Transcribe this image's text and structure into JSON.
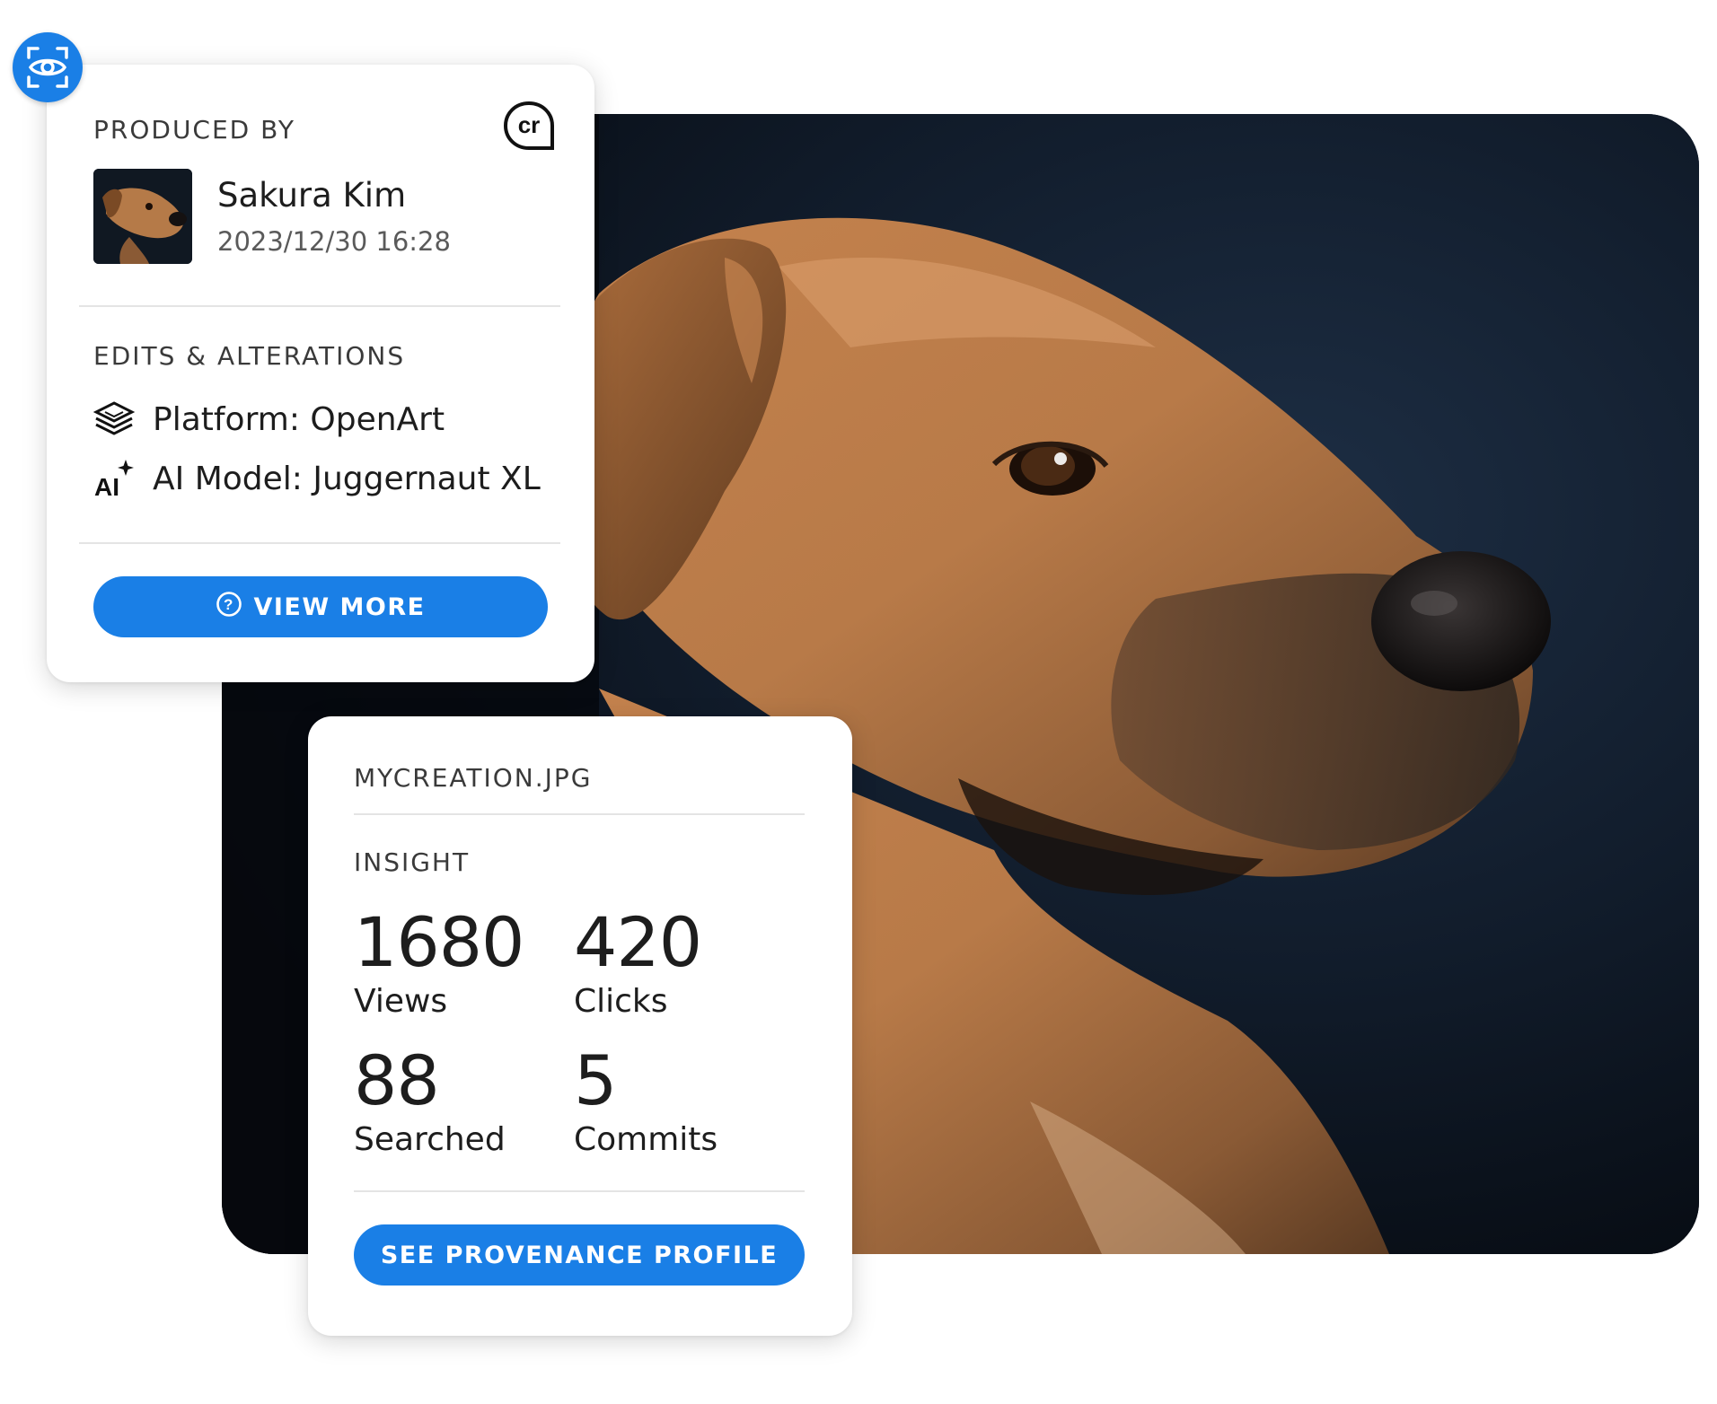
{
  "produced_card": {
    "section_title": "PRODUCED BY",
    "producer_name": "Sakura Kim",
    "produced_date": "2023/12/30 16:28",
    "edits_title": "EDITS & ALTERATIONS",
    "edits": [
      {
        "icon": "layers-icon",
        "text": "Platform: OpenArt"
      },
      {
        "icon": "ai-sparkle-icon",
        "text": "AI Model: Juggernaut XL"
      }
    ],
    "view_more_label": "VIEW MORE",
    "badge_icon": "content-credentials-cr-icon"
  },
  "insight_card": {
    "file_name": "MYCREATION.JPG",
    "insight_title": "INSIGHT",
    "stats": [
      {
        "value": "1680",
        "label": "Views"
      },
      {
        "value": "420",
        "label": "Clicks"
      },
      {
        "value": "88",
        "label": "Searched"
      },
      {
        "value": "5",
        "label": "Commits"
      }
    ],
    "profile_button_label": "SEE PROVENANCE PROFILE"
  },
  "colors": {
    "accent": "#1a7fe6",
    "text": "#1d1d1d",
    "muted": "#5a5a5a",
    "divider": "#e4e4e4"
  }
}
